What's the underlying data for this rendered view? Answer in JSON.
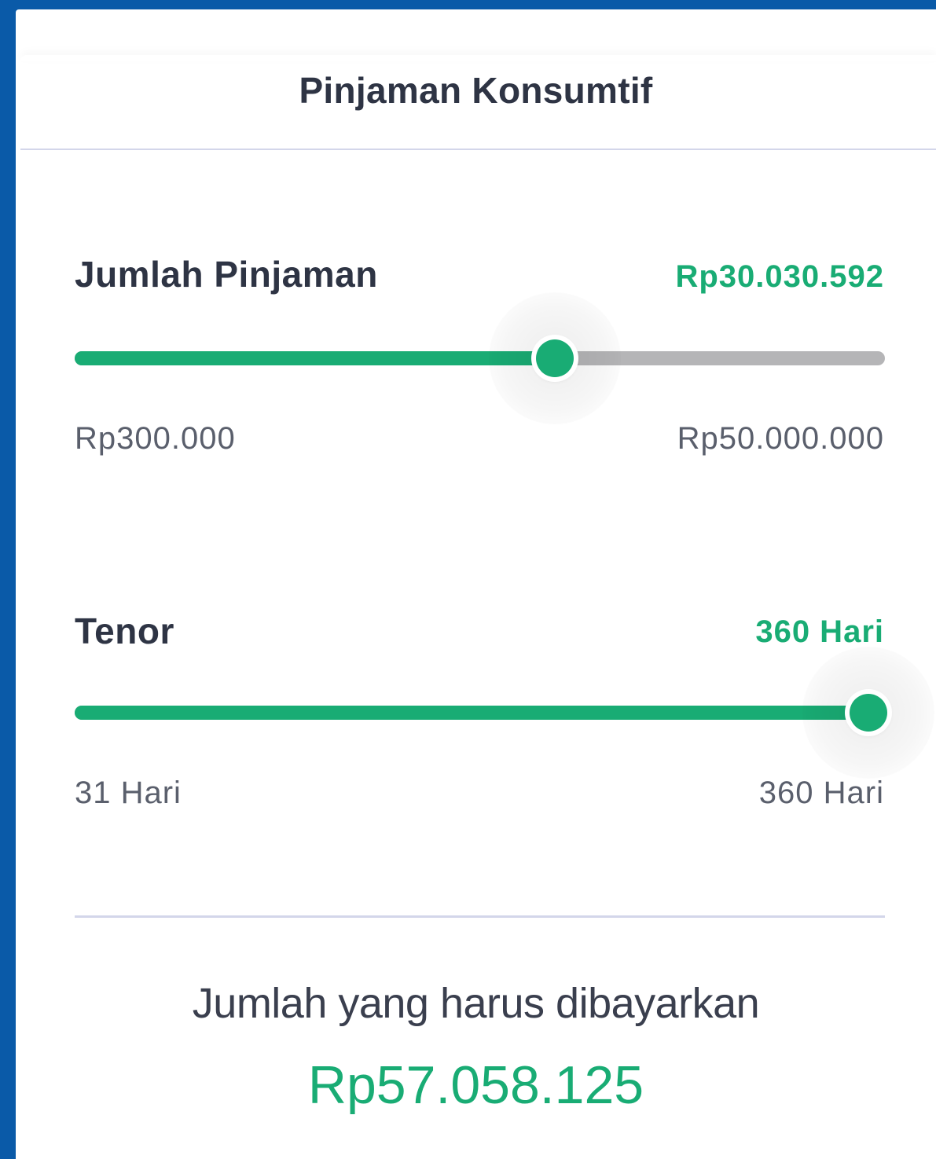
{
  "header": {
    "title": "Pinjaman Konsumtif"
  },
  "loan_amount": {
    "label": "Jumlah Pinjaman",
    "value": "Rp30.030.592",
    "min_label": "Rp300.000",
    "max_label": "Rp50.000.000",
    "fraction": 0.593
  },
  "tenor": {
    "label": "Tenor",
    "value": "360 Hari",
    "min_label": "31 Hari",
    "max_label": "360 Hari",
    "fraction": 0.98
  },
  "summary": {
    "label": "Jumlah yang harus dibayarkan",
    "value": "Rp57.058.125"
  },
  "colors": {
    "accent": "#19ac74",
    "frame": "#0a5aa8",
    "track": "#b5b5b7",
    "text": "#2e3444"
  }
}
